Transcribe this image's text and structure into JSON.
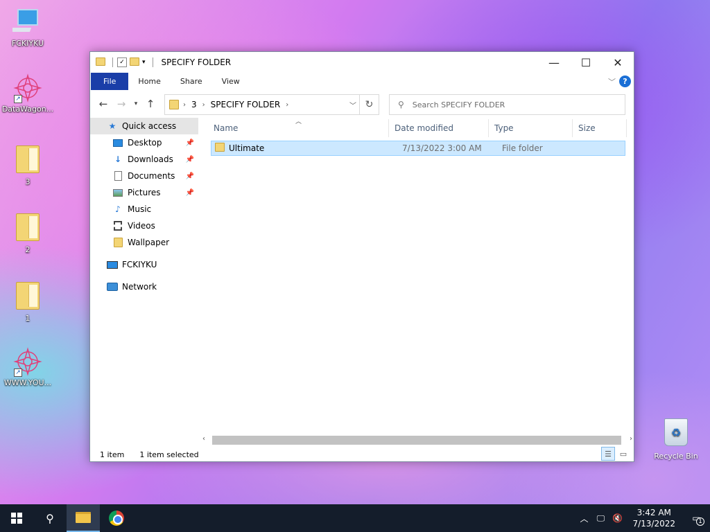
{
  "desktop": {
    "icons": [
      {
        "label": "FCKIYKU"
      },
      {
        "label": "DataWagon..."
      },
      {
        "label": "3"
      },
      {
        "label": "2"
      },
      {
        "label": "1"
      },
      {
        "label": "WWW.YOU..."
      }
    ],
    "recycle_bin": {
      "label": "Recycle Bin"
    }
  },
  "window": {
    "title": "SPECIFY FOLDER",
    "controls": {
      "minimize": "—",
      "maximize": "☐",
      "close": "✕"
    },
    "ribbon": {
      "tabs": [
        "File",
        "Home",
        "Share",
        "View"
      ],
      "help": "?"
    },
    "address": {
      "segments": [
        "3",
        "SPECIFY FOLDER"
      ]
    },
    "search": {
      "placeholder": "Search SPECIFY FOLDER"
    },
    "nav": {
      "quick_access": "Quick access",
      "items": [
        {
          "label": "Desktop",
          "pinned": true
        },
        {
          "label": "Downloads",
          "pinned": true
        },
        {
          "label": "Documents",
          "pinned": true
        },
        {
          "label": "Pictures",
          "pinned": true
        },
        {
          "label": "Music",
          "pinned": false
        },
        {
          "label": "Videos",
          "pinned": false
        },
        {
          "label": "Wallpaper",
          "pinned": false
        }
      ],
      "this_pc": "FCKIYKU",
      "network": "Network"
    },
    "columns": [
      "Name",
      "Date modified",
      "Type",
      "Size"
    ],
    "files": [
      {
        "name": "Ultimate",
        "date_modified": "7/13/2022 3:00 AM",
        "type": "File folder",
        "size": ""
      }
    ],
    "status": {
      "count": "1 item",
      "selected": "1 item selected"
    }
  },
  "taskbar": {
    "time": "3:42 AM",
    "date": "7/13/2022",
    "notification_count": "1"
  },
  "colors": {
    "ribbon_file_tab": "#1a3ea8",
    "selection": "#cce8ff",
    "taskbar": "#141d2b"
  }
}
